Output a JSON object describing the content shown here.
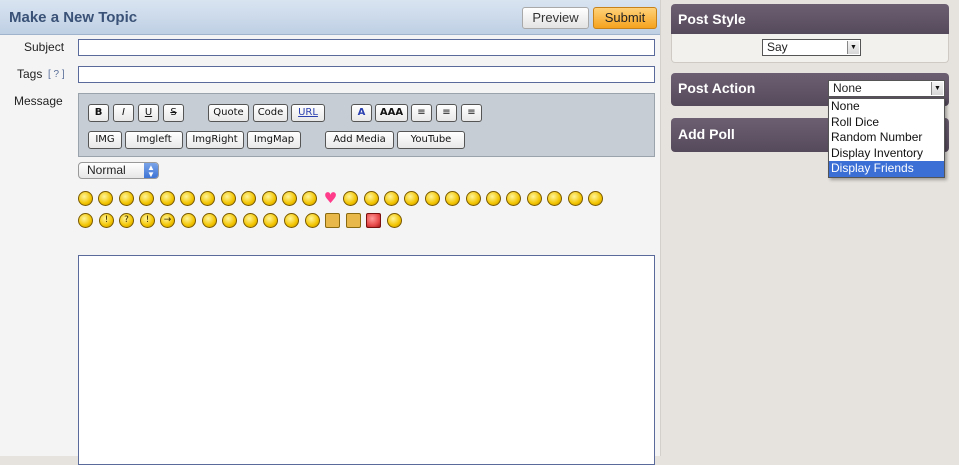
{
  "topic": {
    "title": "Make a New Topic",
    "preview_label": "Preview",
    "submit_label": "Submit"
  },
  "form": {
    "subject_label": "Subject",
    "tags_label": "Tags",
    "tags_help": "[ ? ]",
    "message_label": "Message",
    "subject_value": "",
    "tags_value": "",
    "message_value": ""
  },
  "toolbar": {
    "bold": "B",
    "italic": "I",
    "underline": "U",
    "strike": "S",
    "quote": "Quote",
    "code": "Code",
    "url": "URL",
    "font_color": "A",
    "font_size": "AAA",
    "align_left": "≡",
    "align_center": "≡",
    "align_right": "≡",
    "img": "IMG",
    "imgleft": "Imgleft",
    "imgright": "ImgRight",
    "imgmap": "ImgMap",
    "add_media": "Add Media",
    "youtube": "YouTube"
  },
  "format_select": {
    "value": "Normal"
  },
  "smileys": {
    "row1": [
      "grin",
      "smile",
      "blush",
      "cry",
      "wink",
      "laugh",
      "neutral",
      "tongue",
      "angry",
      "shock",
      "dizzy",
      "sleepy",
      "heart",
      "grimace",
      "happy",
      "content",
      "sad",
      "surprised",
      "confused",
      "cool",
      "lol",
      "worried",
      "cheer",
      "frown",
      "devil",
      "evil"
    ],
    "row2": [
      "eek",
      "exclaim",
      "question",
      "idea",
      "arrow",
      "meh",
      "mrgreen",
      "ninja",
      "kiss",
      "rolleyes",
      "squint",
      "monkey",
      "cheese",
      "unicorn",
      "rss",
      "nerd"
    ]
  },
  "post_style": {
    "title": "Post Style",
    "select_value": "Say"
  },
  "post_action": {
    "title": "Post Action",
    "select_value": "None",
    "options": [
      "None",
      "Roll Dice",
      "Random Number",
      "Display Inventory",
      "Display Friends"
    ],
    "highlighted_index": 4
  },
  "add_poll": {
    "title": "Add Poll"
  },
  "colors": {
    "header_blue": "#bfd0e4",
    "title_text": "#3a5277",
    "submit_orange": "#f5a21e",
    "panel_purple": "#5f5366",
    "dropdown_highlight": "#3b6fd6"
  }
}
